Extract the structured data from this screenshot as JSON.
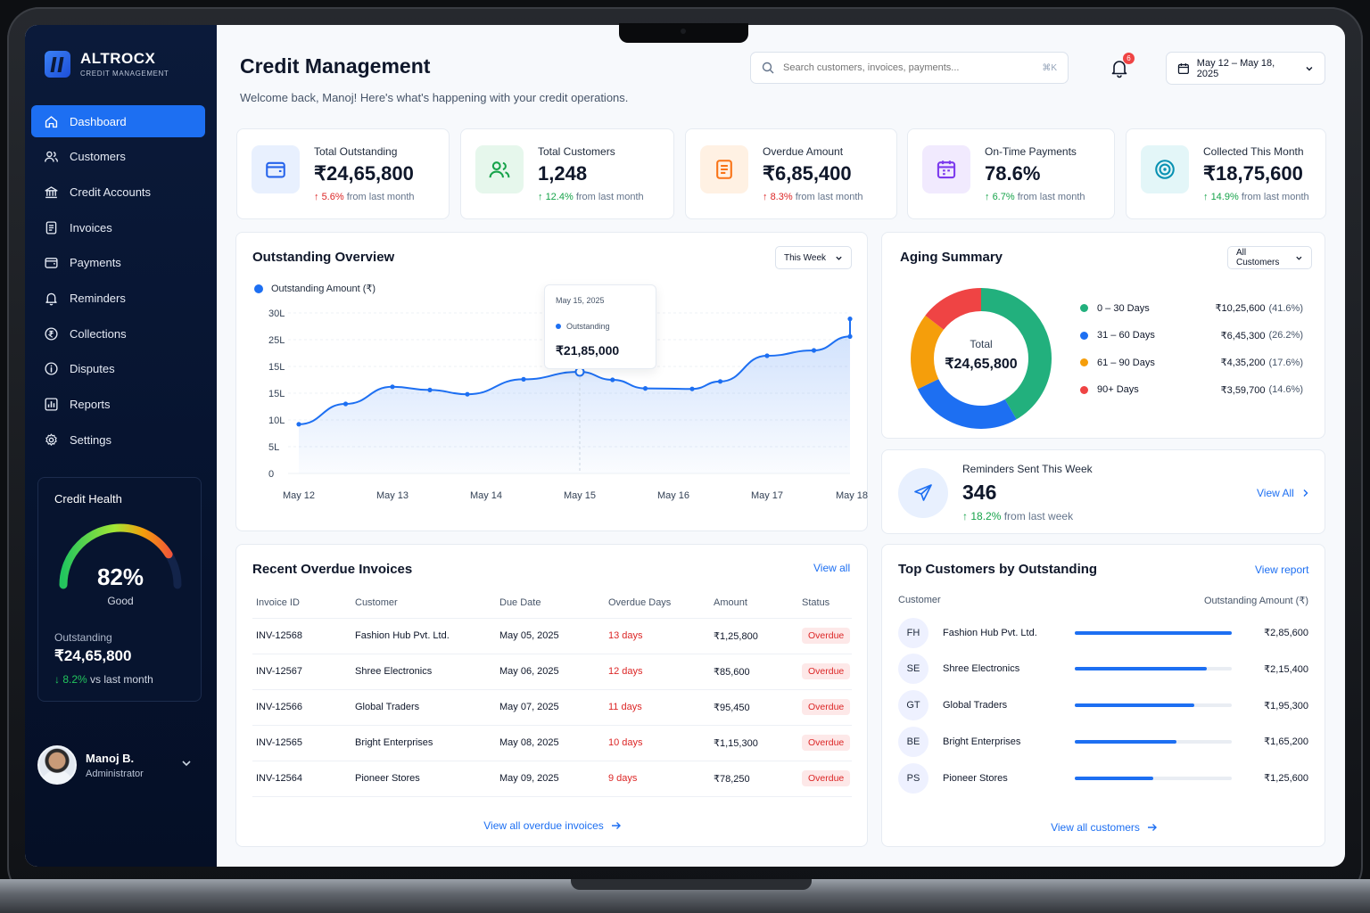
{
  "app": {
    "name": "ALTROCX",
    "subtitle": "CREDIT MANAGEMENT"
  },
  "sidebar": {
    "items": [
      {
        "label": "Dashboard",
        "icon": "home-icon"
      },
      {
        "label": "Customers",
        "icon": "users-icon"
      },
      {
        "label": "Credit Accounts",
        "icon": "bank-icon"
      },
      {
        "label": "Invoices",
        "icon": "document-icon"
      },
      {
        "label": "Payments",
        "icon": "wallet-icon"
      },
      {
        "label": "Reminders",
        "icon": "bell-icon"
      },
      {
        "label": "Collections",
        "icon": "rupee-coin-icon"
      },
      {
        "label": "Disputes",
        "icon": "info-icon"
      },
      {
        "label": "Reports",
        "icon": "bar-chart-icon"
      },
      {
        "label": "Settings",
        "icon": "gear-icon"
      }
    ],
    "active_index": 0,
    "credit_health": {
      "title": "Credit Health",
      "score": "82%",
      "score_value": 82,
      "rating": "Good",
      "outstanding_label": "Outstanding",
      "outstanding": "₹24,65,800",
      "delta": "8.2%",
      "delta_suffix": "vs last month"
    },
    "user": {
      "name": "Manoj B.",
      "role": "Administrator"
    }
  },
  "header": {
    "title": "Credit Management",
    "subtitle": "Welcome back, Manoj! Here's what's happening with your credit operations.",
    "search_placeholder": "Search customers, invoices, payments...",
    "search_shortcut": "⌘K",
    "notification_count": "6",
    "date_range": "May 12 – May 18, 2025"
  },
  "kpis": [
    {
      "label": "Total Outstanding",
      "value": "₹24,65,800",
      "delta": "5.6%",
      "delta_suffix": "from last month",
      "trend": "up-red",
      "icon": "wallet-icon",
      "color": "#2563eb",
      "bg": "#e8f0fe"
    },
    {
      "label": "Total Customers",
      "value": "1,248",
      "delta": "12.4%",
      "delta_suffix": "from last month",
      "trend": "up-green",
      "icon": "users-icon",
      "color": "#16a34a",
      "bg": "#e6f7ec"
    },
    {
      "label": "Overdue Amount",
      "value": "₹6,85,400",
      "delta": "8.3%",
      "delta_suffix": "from last month",
      "trend": "up-red",
      "icon": "document-icon",
      "color": "#f97316",
      "bg": "#fff1e3"
    },
    {
      "label": "On-Time Payments",
      "value": "78.6%",
      "delta": "6.7%",
      "delta_suffix": "from last month",
      "trend": "up-green",
      "icon": "calendar-icon",
      "color": "#7c3aed",
      "bg": "#f1eafe"
    },
    {
      "label": "Collected This Month",
      "value": "₹18,75,600",
      "delta": "14.9%",
      "delta_suffix": "from last month",
      "trend": "up-green",
      "icon": "target-icon",
      "color": "#0891b2",
      "bg": "#e3f6f8"
    }
  ],
  "overview": {
    "title": "Outstanding Overview",
    "filter": "This Week",
    "legend": "Outstanding Amount (₹)",
    "tooltip": {
      "date": "May 15, 2025",
      "series": "Outstanding",
      "value": "₹21,85,000"
    }
  },
  "chart_data": {
    "type": "line",
    "title": "Outstanding Overview",
    "series": [
      {
        "name": "Outstanding Amount (₹)",
        "values": [
          9.2,
          13.0,
          16.2,
          15.6,
          14.8,
          17.6,
          19.0,
          17.5,
          15.9,
          15.8,
          17.2,
          22.0,
          23.0,
          25.6,
          28.9
        ]
      }
    ],
    "x": [
      0,
      0.5,
      1,
      1.4,
      1.8,
      2.4,
      3,
      3.35,
      3.7,
      4.2,
      4.5,
      5,
      5.5,
      5.9,
      6.3
    ],
    "x_ticks": [
      "May 12",
      "May 13",
      "May 14",
      "May 15",
      "May 16",
      "May 17",
      "May 18"
    ],
    "y_ticks": [
      "0",
      "5L",
      "10L",
      "15L",
      "15L",
      "25L",
      "30L"
    ],
    "ylim": [
      0,
      30
    ],
    "color": "#1d6ff2",
    "highlight_index": 6,
    "grid": true
  },
  "aging": {
    "title": "Aging Summary",
    "filter": "All Customers",
    "total_label": "Total",
    "total": "₹24,65,800",
    "buckets": [
      {
        "label": "0 – 30 Days",
        "value": "₹10,25,600",
        "pct": "(41.6%)",
        "share": 41.6,
        "color": "#22b07d"
      },
      {
        "label": "31 – 60 Days",
        "value": "₹6,45,300",
        "pct": "(26.2%)",
        "share": 26.2,
        "color": "#1d6ff2"
      },
      {
        "label": "61 – 90 Days",
        "value": "₹4,35,200",
        "pct": "(17.6%)",
        "share": 17.6,
        "color": "#f59e0b"
      },
      {
        "label": "90+ Days",
        "value": "₹3,59,700",
        "pct": "(14.6%)",
        "share": 14.6,
        "color": "#ef4444"
      }
    ]
  },
  "reminders": {
    "title": "Reminders Sent This Week",
    "value": "346",
    "delta": "18.2%",
    "delta_suffix": "from last week",
    "link": "View All"
  },
  "overdue": {
    "title": "Recent Overdue Invoices",
    "link": "View all",
    "columns": [
      "Invoice ID",
      "Customer",
      "Due Date",
      "Overdue Days",
      "Amount",
      "Status"
    ],
    "rows": [
      [
        "INV-12568",
        "Fashion Hub Pvt. Ltd.",
        "May 05, 2025",
        "13 days",
        "₹1,25,800",
        "Overdue"
      ],
      [
        "INV-12567",
        "Shree Electronics",
        "May 06, 2025",
        "12 days",
        "₹85,600",
        "Overdue"
      ],
      [
        "INV-12566",
        "Global Traders",
        "May 07, 2025",
        "11 days",
        "₹95,450",
        "Overdue"
      ],
      [
        "INV-12565",
        "Bright Enterprises",
        "May 08, 2025",
        "10 days",
        "₹1,15,300",
        "Overdue"
      ],
      [
        "INV-12564",
        "Pioneer Stores",
        "May 09, 2025",
        "9 days",
        "₹78,250",
        "Overdue"
      ]
    ],
    "footer_link": "View all overdue invoices"
  },
  "top_customers": {
    "title": "Top Customers by Outstanding",
    "link": "View report",
    "col_customer": "Customer",
    "col_amount": "Outstanding Amount (₹)",
    "rows": [
      {
        "initials": "FH",
        "name": "Fashion Hub Pvt. Ltd.",
        "amount": "₹2,85,600",
        "share": 1.0
      },
      {
        "initials": "SE",
        "name": "Shree Electronics",
        "amount": "₹2,15,400",
        "share": 0.84
      },
      {
        "initials": "GT",
        "name": "Global Traders",
        "amount": "₹1,95,300",
        "share": 0.76
      },
      {
        "initials": "BE",
        "name": "Bright Enterprises",
        "amount": "₹1,65,200",
        "share": 0.65
      },
      {
        "initials": "PS",
        "name": "Pioneer Stores",
        "amount": "₹1,25,600",
        "share": 0.5
      }
    ],
    "footer_link": "View all customers"
  }
}
